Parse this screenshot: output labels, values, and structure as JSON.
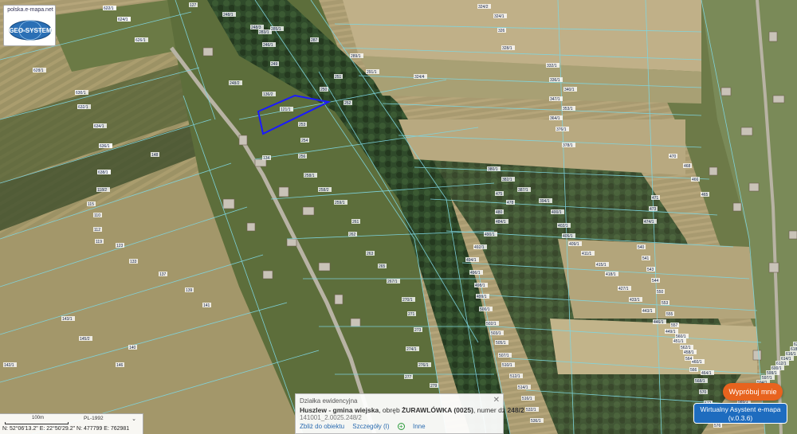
{
  "logo": {
    "url_text": "polska.e-mapa.net",
    "wordmark": "GEO-SYSTEM"
  },
  "parcel_labels": [
    "134/1",
    "114/2",
    "113",
    "87",
    "108",
    "120",
    "115",
    "116/1",
    "116/2",
    "118/2",
    "115",
    "110",
    "112",
    "119",
    "123",
    "133",
    "137",
    "139",
    "141",
    "143/1",
    "145/2",
    "140",
    "146",
    "142/1",
    "144",
    "148",
    "127",
    "121/1",
    "136/2",
    "134",
    "248/2",
    "248/1",
    "248/3",
    "246/1",
    "249",
    "250",
    "251",
    "252",
    "253",
    "254",
    "256",
    "258/1",
    "258/2",
    "259/1",
    "261",
    "262",
    "263",
    "265",
    "267/1",
    "270/1",
    "271",
    "273",
    "274/1",
    "276/1",
    "277",
    "279",
    "283/1",
    "285/1",
    "287",
    "289/1",
    "291/1",
    "324/4",
    "324/2",
    "324/1",
    "326",
    "328/1",
    "332/1",
    "336/1",
    "340/1",
    "347/1",
    "353/1",
    "364/1",
    "376/1",
    "378/1",
    "380/1",
    "382/1",
    "387/1",
    "394/1",
    "400/1",
    "402/1",
    "405/1",
    "409/1",
    "411/1",
    "415/1",
    "418/1",
    "427/1",
    "433/1",
    "443/1",
    "446/1",
    "449/1",
    "451/1",
    "458/1",
    "460/1",
    "464/1",
    "465",
    "466",
    "468",
    "470",
    "471",
    "473",
    "474/1",
    "475",
    "478",
    "480",
    "484/1",
    "490/1",
    "492/1",
    "494/1",
    "496/1",
    "498/1",
    "499/1",
    "500/1",
    "502/1",
    "503/1",
    "505/1",
    "507/1",
    "510/1",
    "512/1",
    "514/1",
    "516/1",
    "532/1",
    "536/1",
    "540",
    "541",
    "543",
    "544",
    "550",
    "553",
    "555",
    "557",
    "560/1",
    "562/1",
    "564",
    "566",
    "568/1",
    "570",
    "572",
    "574",
    "576",
    "578",
    "580/1",
    "582/1",
    "583",
    "585/1",
    "587/1",
    "589/1",
    "591",
    "594/1",
    "597/1",
    "599/1",
    "600/1",
    "612/1",
    "614/1",
    "616/1",
    "618/1",
    "620/1",
    "622/1",
    "624/1",
    "626/1",
    "628/1",
    "630/1",
    "632/1",
    "634/1",
    "636/1",
    "638/1"
  ],
  "info_panel": {
    "title": "Działka ewidencyjna",
    "municipality": "Huszlew - gmina wiejska",
    "precinct_prefix": ", obręb ",
    "precinct": "ŻURAWLÓWKA (0025)",
    "number_prefix": ", numer dz ",
    "number": "248/2",
    "parcel_id": "141001_2.0025.248/2",
    "link_zoom": "Zbliż do obiektu",
    "link_details": "Szczegóły (I)",
    "link_other": "Inne",
    "close_icon": "close-icon"
  },
  "scale": {
    "label": "100m",
    "projection": "PL-1992",
    "coords": "N: 52°06'13.2\"  E: 22°50'29.2\"  N: 477799   E: 762981"
  },
  "buttons": {
    "try_label": "Wypróbuj mnie",
    "assistant_line1": "Wirtualny Asystent e-mapa",
    "assistant_line2": "(v.0.3.6)"
  },
  "colors": {
    "parcel_lines": "#7fd6e0",
    "selected_parcel": "#1a1aff",
    "accent_orange": "#e8631e",
    "accent_blue": "#1e6cbf"
  }
}
